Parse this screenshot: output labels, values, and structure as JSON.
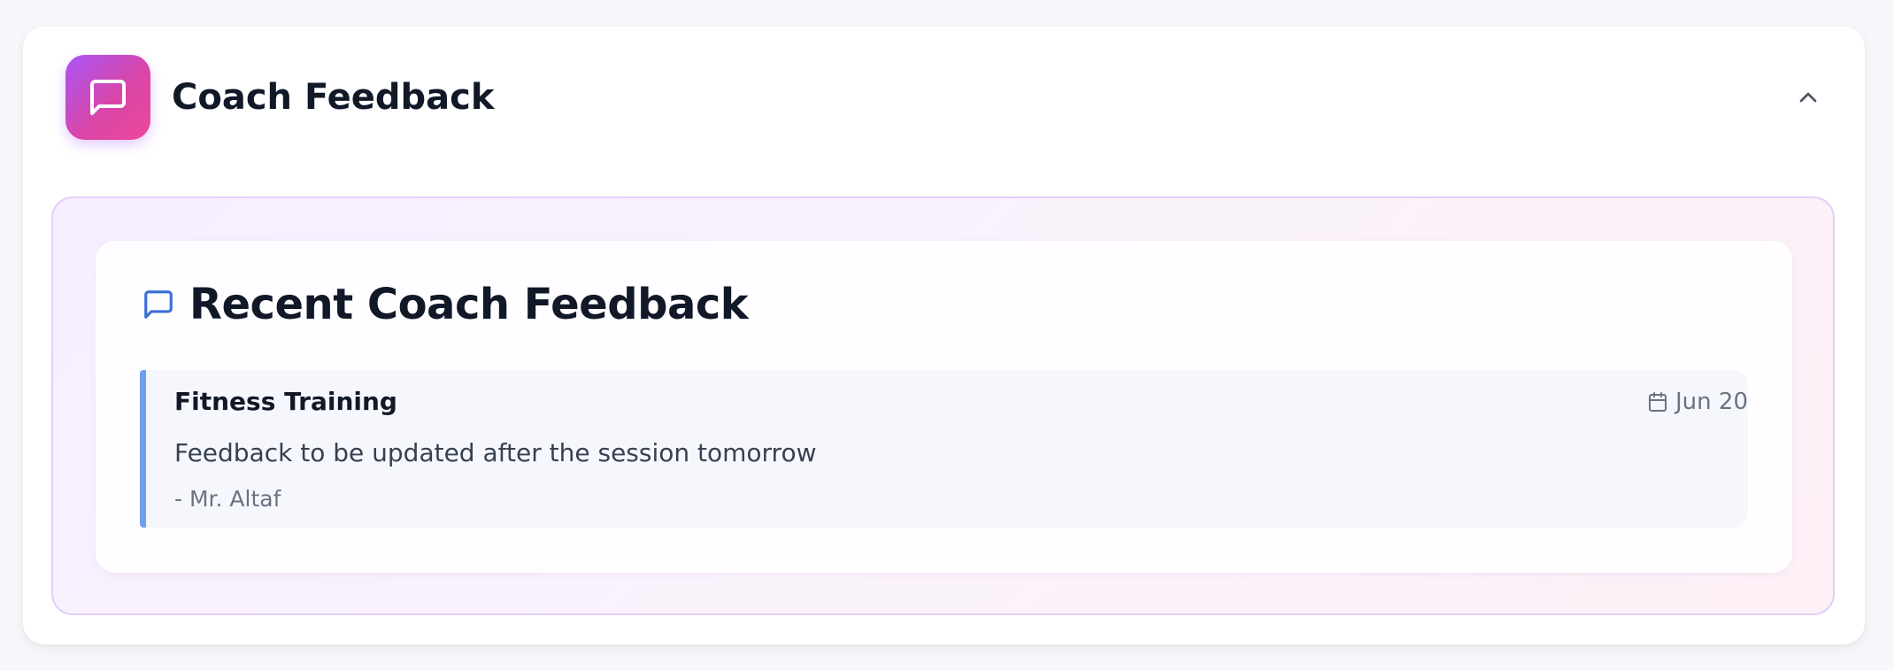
{
  "header": {
    "title": "Coach Feedback",
    "icon": "message-square-icon",
    "toggle_icon": "chevron-up-icon"
  },
  "section": {
    "title": "Recent Coach Feedback",
    "icon": "message-square-icon"
  },
  "feedback": [
    {
      "subject": "Fitness Training",
      "date": "Jun 20",
      "text": "Feedback to be updated after the session tomorrow",
      "author": "- Mr. Altaf"
    }
  ],
  "colors": {
    "accent_gradient_start": "#a855f7",
    "accent_gradient_end": "#ec4899",
    "feedback_border": "#6ea0ec",
    "section_icon": "#3b6fd8"
  }
}
